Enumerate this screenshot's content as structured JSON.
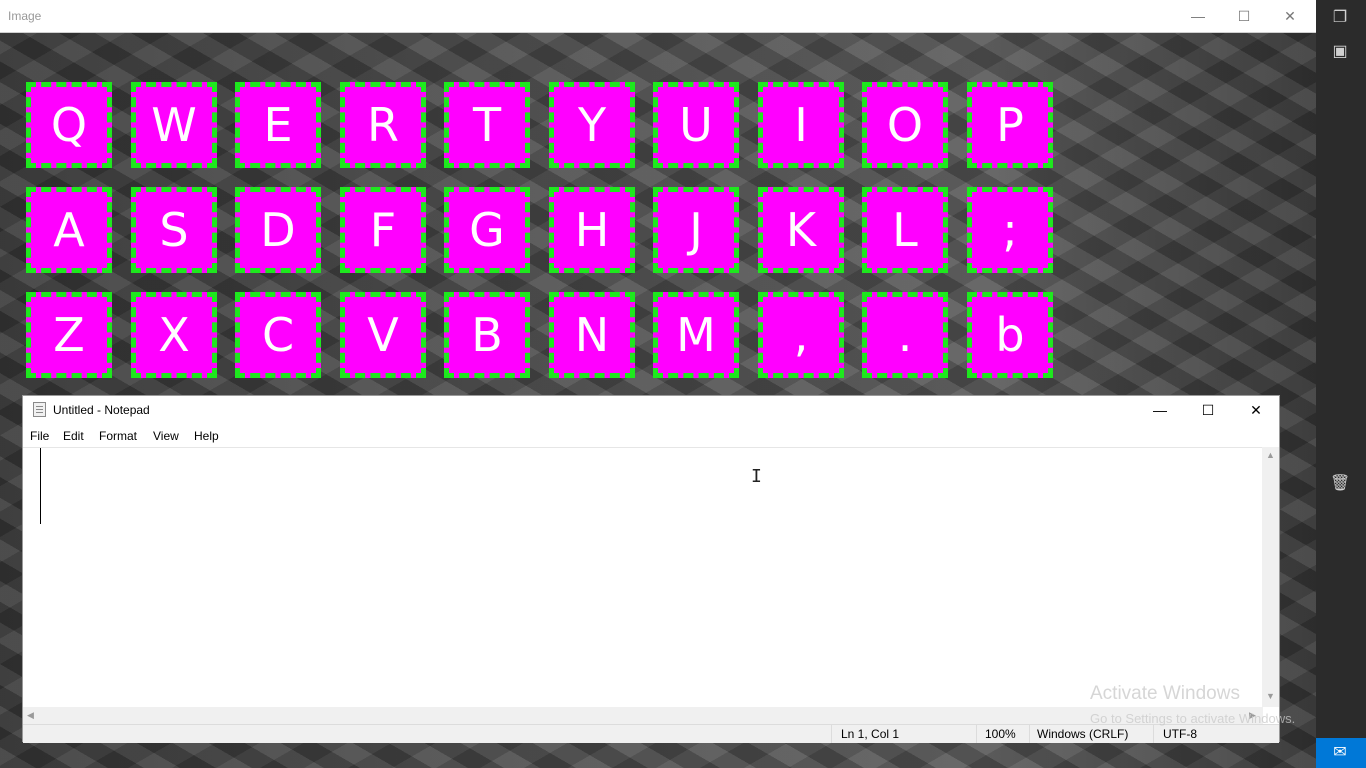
{
  "image_window": {
    "title": "Image",
    "controls": {
      "minimize": "—",
      "maximize": "☐",
      "close": "✕"
    }
  },
  "keyboard": {
    "key_color": "#ff00ff",
    "border_color": "#1ee81e",
    "rows": [
      [
        "Q",
        "W",
        "E",
        "R",
        "T",
        "Y",
        "U",
        "I",
        "O",
        "P"
      ],
      [
        "A",
        "S",
        "D",
        "F",
        "G",
        "H",
        "J",
        "K",
        "L",
        ";"
      ],
      [
        "Z",
        "X",
        "C",
        "V",
        "B",
        "N",
        "M",
        ",",
        ".",
        "b"
      ]
    ]
  },
  "notepad": {
    "title": "Untitled - Notepad",
    "controls": {
      "minimize": "—",
      "maximize": "☐",
      "close": "✕"
    },
    "menu": [
      "File",
      "Edit",
      "Format",
      "View",
      "Help"
    ],
    "content": "",
    "status": {
      "position": "Ln 1, Col 1",
      "zoom": "100%",
      "line_endings": "Windows (CRLF)",
      "encoding": "UTF-8"
    }
  },
  "watermark": {
    "line1": "Activate Windows",
    "line2": "Go to Settings to activate Windows."
  },
  "desktop": {
    "taskbar_color": "#0078d7"
  }
}
